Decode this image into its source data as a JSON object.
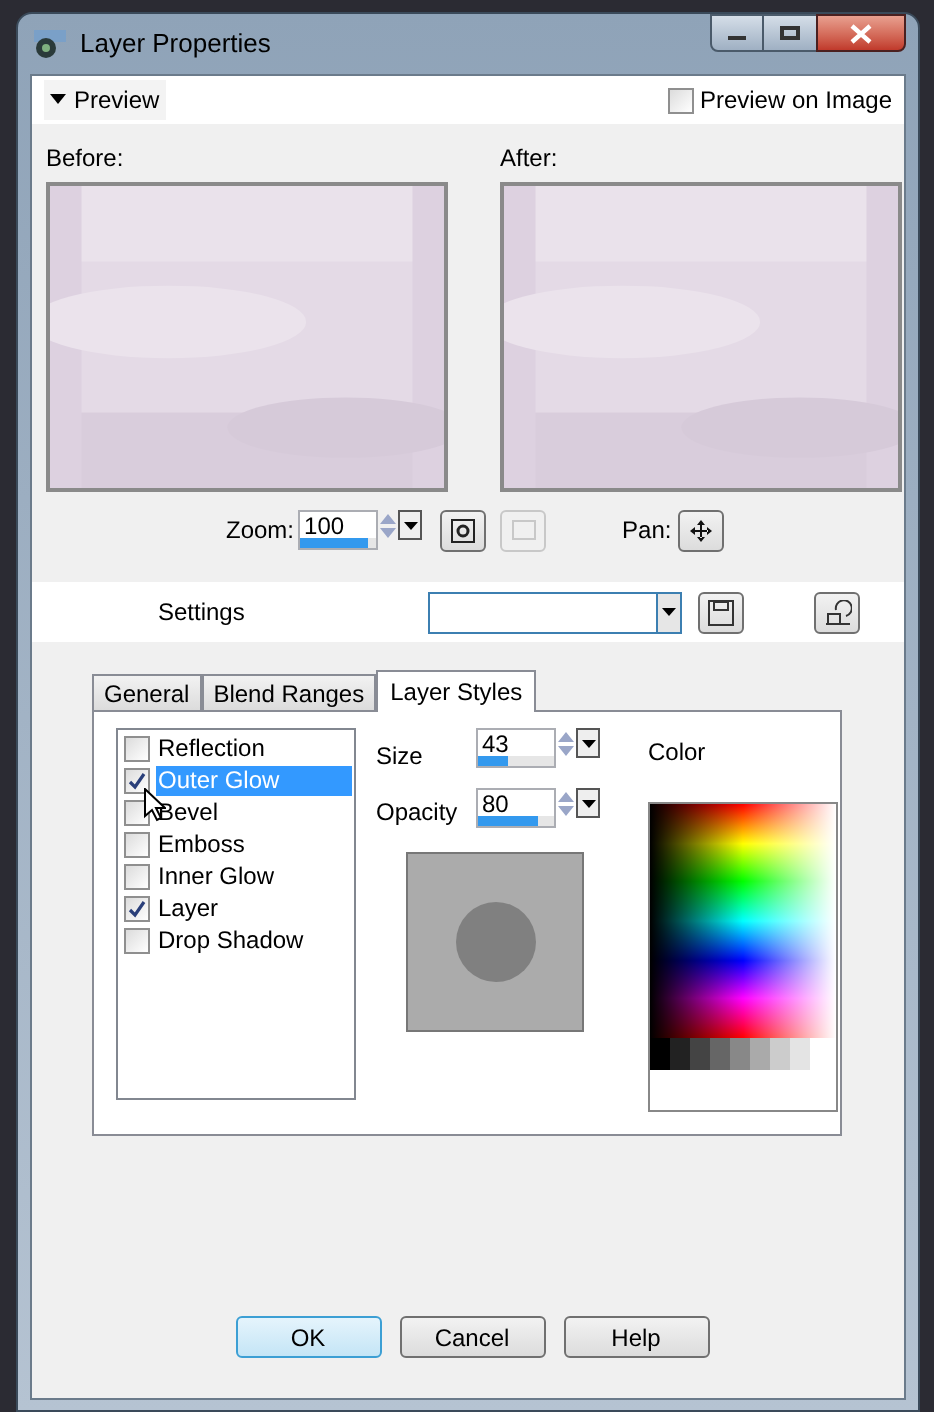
{
  "window": {
    "title": "Layer Properties"
  },
  "preview": {
    "toggle": "Preview",
    "expanded": true,
    "on_image": {
      "label": "Preview on Image",
      "checked": false
    },
    "before_label": "Before:",
    "after_label": "After:",
    "zoom": {
      "label": "Zoom:",
      "value": "100",
      "level": 0.9
    },
    "pan_label": "Pan:"
  },
  "settings": {
    "label": "Settings"
  },
  "tabs": [
    {
      "label": "General",
      "selected": false
    },
    {
      "label": "Blend Ranges",
      "selected": false
    },
    {
      "label": "Layer Styles",
      "selected": true
    }
  ],
  "effects": [
    {
      "label": "Reflection",
      "checked": false,
      "selected": false
    },
    {
      "label": "Outer Glow",
      "checked": true,
      "selected": true
    },
    {
      "label": "Bevel",
      "checked": false,
      "selected": false
    },
    {
      "label": "Emboss",
      "checked": false,
      "selected": false
    },
    {
      "label": "Inner Glow",
      "checked": false,
      "selected": false
    },
    {
      "label": "Layer",
      "checked": true,
      "selected": false
    },
    {
      "label": "Drop Shadow",
      "checked": false,
      "selected": false
    }
  ],
  "size": {
    "label": "Size",
    "value": "43",
    "level": 0.4
  },
  "opacity": {
    "label": "Opacity",
    "value": "80",
    "level": 0.8
  },
  "color_label": "Color",
  "buttons": [
    {
      "label": "OK",
      "default": true
    },
    {
      "label": "Cancel",
      "default": false
    },
    {
      "label": "Help",
      "default": false
    }
  ]
}
